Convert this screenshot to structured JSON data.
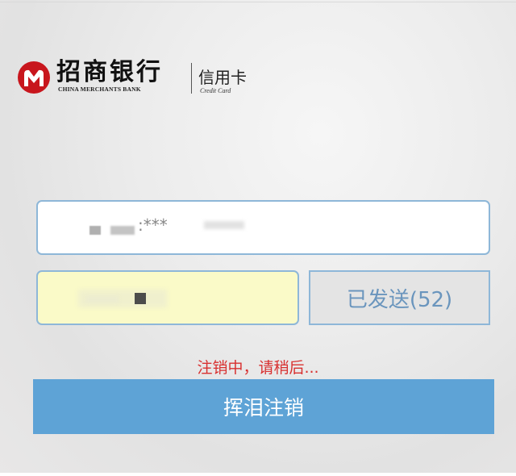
{
  "logo": {
    "cn_name": "招商银行",
    "en_name": "CHINA MERCHANTS BANK",
    "sub_cn": "信用卡",
    "sub_en": "Credit Card",
    "brand_color": "#c8161d"
  },
  "form": {
    "phone_value": ":***",
    "send_code_label": "已发送(52)",
    "status_text": "注销中，请稍后...",
    "submit_label": "挥泪注销"
  },
  "colors": {
    "field_border": "#8eb7d8",
    "code_field_bg": "#fafac8",
    "send_text": "#6a95bd",
    "status": "#d8302f",
    "submit_bg": "#5ea3d6"
  }
}
